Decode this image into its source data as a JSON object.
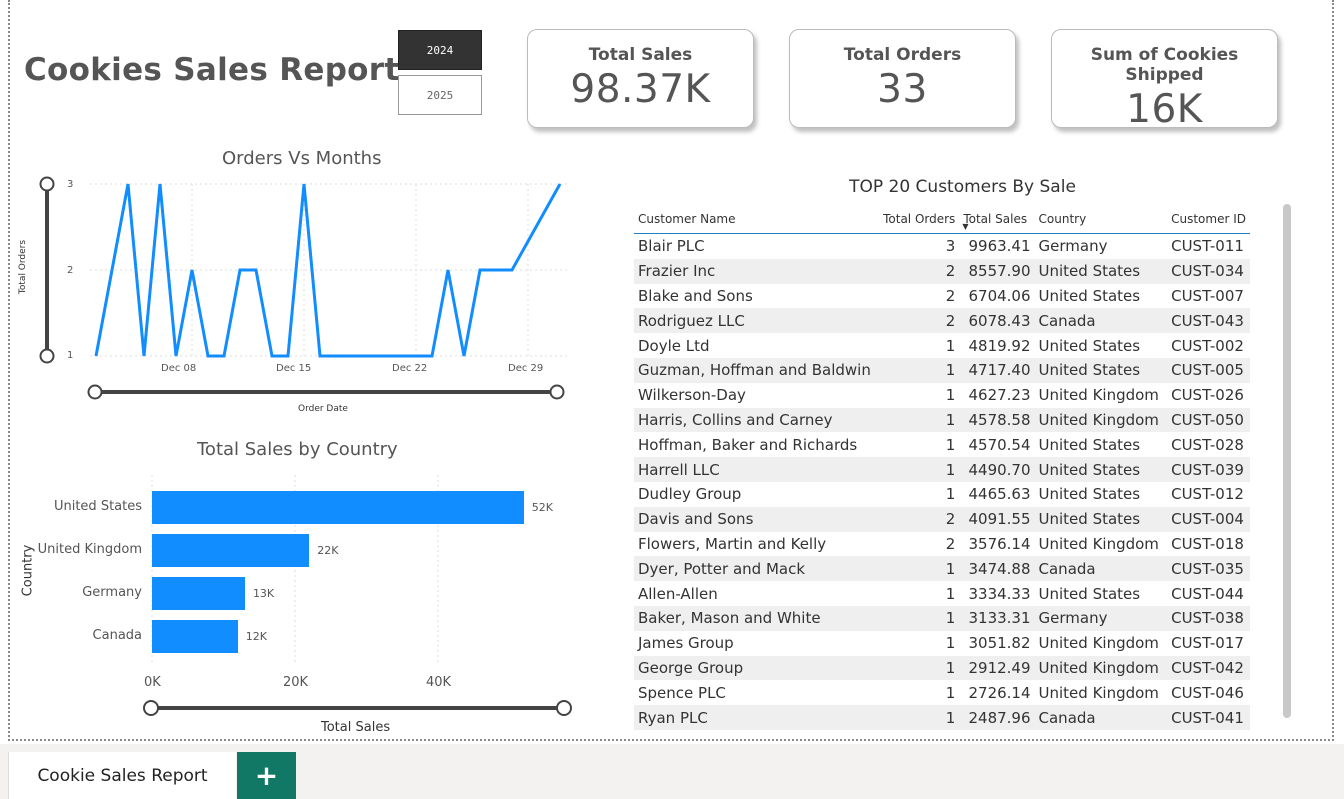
{
  "report": {
    "title": "Cookies Sales Report",
    "years": [
      "2024",
      "2025"
    ],
    "selected_year": "2024"
  },
  "kpis": [
    {
      "label": "Total Sales",
      "value": "98.37K"
    },
    {
      "label": "Total Orders",
      "value": "33"
    },
    {
      "label": "Sum of Cookies Shipped",
      "value": "16K"
    }
  ],
  "line_chart": {
    "title": "Orders Vs Months",
    "ylabel": "Total Orders",
    "xlabel": "Order Date",
    "yticks": [
      "3",
      "2",
      "1"
    ],
    "xticks": [
      "Dec 08",
      "Dec 15",
      "Dec 22",
      "Dec 29"
    ],
    "color": "#118DFF"
  },
  "bar_chart": {
    "title": "Total Sales by Country",
    "ylabel": "Country",
    "xlabel": "Total Sales",
    "xticks": [
      "0K",
      "20K",
      "40K"
    ],
    "color": "#118DFF"
  },
  "chart_data": [
    {
      "type": "line",
      "title": "Orders Vs Months",
      "xlabel": "Order Date",
      "ylabel": "Total Orders",
      "ylim": [
        1,
        3
      ],
      "x": [
        "2024-12-02",
        "2024-12-04",
        "2024-12-05",
        "2024-12-06",
        "2024-12-07",
        "2024-12-08",
        "2024-12-09",
        "2024-12-10",
        "2024-12-11",
        "2024-12-12",
        "2024-12-13",
        "2024-12-14",
        "2024-12-15",
        "2024-12-16",
        "2024-12-17",
        "2024-12-23",
        "2024-12-24",
        "2024-12-25",
        "2024-12-26",
        "2024-12-28",
        "2024-12-31"
      ],
      "series": [
        {
          "values": [
            1,
            3,
            1,
            3,
            1,
            2,
            1,
            1,
            2,
            2,
            1,
            1,
            3,
            1,
            1,
            1,
            2,
            1,
            2,
            2,
            3
          ]
        }
      ]
    },
    {
      "type": "bar",
      "title": "Total Sales by Country",
      "xlabel": "Total Sales",
      "ylabel": "Country",
      "categories": [
        "United States",
        "United Kingdom",
        "Germany",
        "Canada"
      ],
      "values": [
        52000,
        22000,
        13000,
        12000
      ],
      "value_labels": [
        "52K",
        "22K",
        "13K",
        "12K"
      ],
      "xlim": [
        0,
        60000
      ]
    }
  ],
  "table": {
    "title": "TOP 20 Customers By Sale",
    "columns": [
      "Customer Name",
      "Total Orders",
      "Total Sales",
      "Country",
      "Customer ID"
    ],
    "rows": [
      [
        "Blair PLC",
        "3",
        "9963.41",
        "Germany",
        "CUST-011"
      ],
      [
        "Frazier Inc",
        "2",
        "8557.90",
        "United States",
        "CUST-034"
      ],
      [
        "Blake and Sons",
        "2",
        "6704.06",
        "United States",
        "CUST-007"
      ],
      [
        "Rodriguez LLC",
        "2",
        "6078.43",
        "Canada",
        "CUST-043"
      ],
      [
        "Doyle Ltd",
        "1",
        "4819.92",
        "United States",
        "CUST-002"
      ],
      [
        "Guzman, Hoffman and Baldwin",
        "1",
        "4717.40",
        "United States",
        "CUST-005"
      ],
      [
        "Wilkerson-Day",
        "1",
        "4627.23",
        "United Kingdom",
        "CUST-026"
      ],
      [
        "Harris, Collins and Carney",
        "1",
        "4578.58",
        "United Kingdom",
        "CUST-050"
      ],
      [
        "Hoffman, Baker and Richards",
        "1",
        "4570.54",
        "United States",
        "CUST-028"
      ],
      [
        "Harrell LLC",
        "1",
        "4490.70",
        "United States",
        "CUST-039"
      ],
      [
        "Dudley Group",
        "1",
        "4465.63",
        "United States",
        "CUST-012"
      ],
      [
        "Davis and Sons",
        "2",
        "4091.55",
        "United States",
        "CUST-004"
      ],
      [
        "Flowers, Martin and Kelly",
        "2",
        "3576.14",
        "United Kingdom",
        "CUST-018"
      ],
      [
        "Dyer, Potter and Mack",
        "1",
        "3474.88",
        "Canada",
        "CUST-035"
      ],
      [
        "Allen-Allen",
        "1",
        "3334.33",
        "United States",
        "CUST-044"
      ],
      [
        "Baker, Mason and White",
        "1",
        "3133.31",
        "Germany",
        "CUST-038"
      ],
      [
        "James Group",
        "1",
        "3051.82",
        "United Kingdom",
        "CUST-017"
      ],
      [
        "George Group",
        "1",
        "2912.49",
        "United Kingdom",
        "CUST-042"
      ],
      [
        "Spence PLC",
        "1",
        "2726.14",
        "United Kingdom",
        "CUST-046"
      ],
      [
        "Ryan PLC",
        "1",
        "2487.96",
        "Canada",
        "CUST-041"
      ]
    ]
  },
  "tabs": {
    "active": "Cookie Sales Report",
    "add_label": "+"
  }
}
